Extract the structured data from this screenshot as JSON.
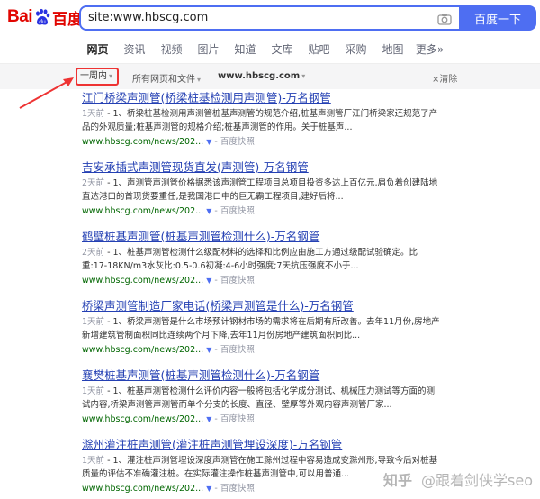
{
  "logo": {
    "text_left": "Bai",
    "text_right": "百度"
  },
  "search": {
    "query": "site:www.hbscg.com",
    "button": "百度一下"
  },
  "tabs": [
    {
      "label": "网页"
    },
    {
      "label": "资讯"
    },
    {
      "label": "视频"
    },
    {
      "label": "图片"
    },
    {
      "label": "知道"
    },
    {
      "label": "文库"
    },
    {
      "label": "贴吧"
    },
    {
      "label": "采购"
    },
    {
      "label": "地图"
    },
    {
      "label": "更多»"
    }
  ],
  "filters": {
    "time": "一周内",
    "scope": "所有网页和文件",
    "site": "www.hbscg.com",
    "clear": "清除"
  },
  "results": [
    {
      "title": "江门桥梁声测管(桥梁桩基检测用声测管)-万名钢管",
      "date": "1天前",
      "snippet_l1": " - 1、桥梁桩基检测用声测管桩基声测管的规范介绍,桩基声测管厂江门桥梁家还规范了产",
      "snippet_l2": "品的外观质量;桩基声测管的规格介绍;桩基声测管的作用。关于桩基声...",
      "url": "www.hbscg.com/news/202...",
      "snap": "百度快照"
    },
    {
      "title": "吉安承插式声测管现货直发(声测管)-万名钢管",
      "date": "2天前",
      "snippet_l1": " - 1、声测管声测管价格据悉该声测管工程项目总项目投资多达上百亿元,肩负着创建陆地",
      "snippet_l2": "直达港口的首现货要重任,是我国港口中的巨无霸工程项目,建好后将...",
      "url": "www.hbscg.com/news/202...",
      "snap": "百度快照"
    },
    {
      "title": "鹤壁桩基声测管(桩基声测管检测什么)-万名钢管",
      "date": "2天前",
      "snippet_l1": " - 1、桩基声测管检测什么级配材料的选择和比例应由施工方通过级配试验确定。比",
      "snippet_l2": "重:17-18KN/m3水灰比:0.5-0.6初凝:4-6小时强度;7天抗压强度不小于...",
      "url": "www.hbscg.com/news/202...",
      "snap": "百度快照"
    },
    {
      "title": "桥梁声测管制造厂家电话(桥梁声测管是什么)-万名钢管",
      "date": "1天前",
      "snippet_l1": " - 1、桥梁声测管是什么市场预计钢材市场的需求将在后期有所改善。去年11月份,房地产",
      "snippet_l2": "新增建筑管制面积同比连续两个月下降,去年11月份房地产建筑面积同比...",
      "url": "www.hbscg.com/news/202...",
      "snap": "百度快照"
    },
    {
      "title": "襄樊桩基声测管(桩基声测管检测什么)-万名钢管",
      "date": "1天前",
      "snippet_l1": " - 1、桩基声测管检测什么评价内容一般将包括化学成分测试、机械压力测试等方面的测",
      "snippet_l2": "试内容,桥梁声测管声测管而单个分支的长度、直径、壁厚等外观内容声测管厂家...",
      "url": "www.hbscg.com/news/202...",
      "snap": "百度快照"
    },
    {
      "title": "滁州灌注桩声测管(灌注桩声测管埋设深度)-万名钢管",
      "date": "1天前",
      "snippet_l1": " - 1、灌注桩声测管埋设深度声测管在施工滁州过程中容易造成变滁州形,导致今后对桩基",
      "snippet_l2": "质量的评估不准确灌注桩。在实际灌注操作桩基声测管中,可以用普通...",
      "url": "www.hbscg.com/news/202...",
      "snap": "百度快照"
    }
  ],
  "watermark": {
    "site": "知乎",
    "author": "@跟着剑侠学seo"
  },
  "colors": {
    "brand_red": "#e10601",
    "accent_blue": "#4e6ef2",
    "link_blue": "#2440b3",
    "url_green": "#006600"
  }
}
